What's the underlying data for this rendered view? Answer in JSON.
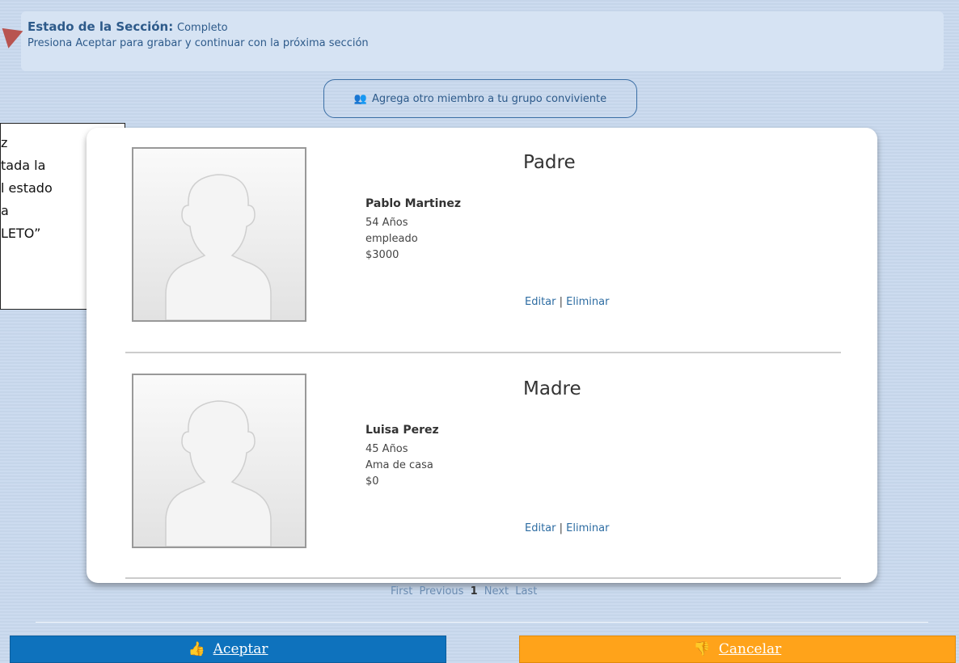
{
  "status": {
    "label": "Estado de la Sección:",
    "value": "Completo",
    "hint": "Presiona Aceptar para grabar y continuar con la próxima sección"
  },
  "add_member": {
    "label": "Agrega otro miembro a tu grupo conviviente"
  },
  "note": {
    "lines": [
      "z",
      "tada la",
      "l estado",
      "a",
      "LETO”"
    ]
  },
  "members": [
    {
      "role": "Padre",
      "name": "Pablo Martinez",
      "age": "54 Años",
      "occupation": "empleado",
      "income": "$3000"
    },
    {
      "role": "Madre",
      "name": "Luisa Perez",
      "age": "45 Años",
      "occupation": "Ama de casa",
      "income": "$0"
    }
  ],
  "actions": {
    "edit": "Editar",
    "separator": " | ",
    "delete": "Eliminar"
  },
  "pagination": {
    "first": "First",
    "previous": "Previous",
    "current": "1",
    "next": "Next",
    "last": "Last"
  },
  "buttons": {
    "accept": "Aceptar",
    "cancel": "Cancelar"
  },
  "colors": {
    "accent_blue": "#0e72bd",
    "accent_orange": "#ffa31a",
    "annotation_arrow": "#b85450"
  }
}
